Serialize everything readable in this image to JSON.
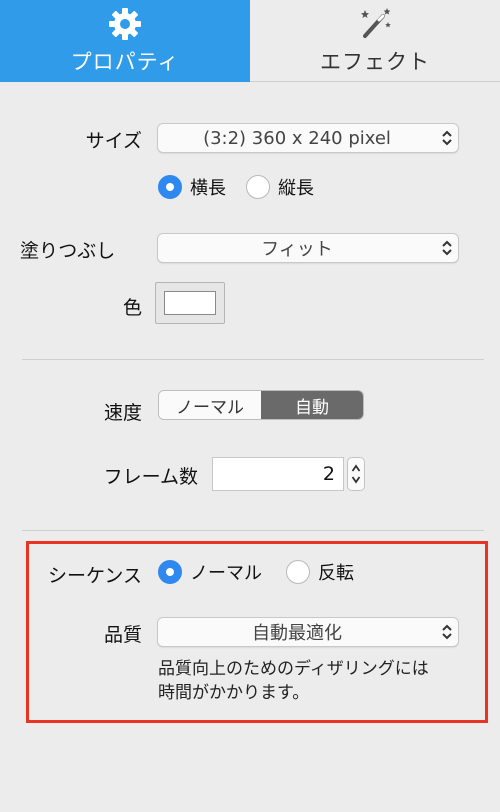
{
  "tabs": {
    "properties": {
      "label": "プロパティ",
      "icon": "gear-icon",
      "active": true,
      "color": "#2f9be9"
    },
    "effects": {
      "label": "エフェクト",
      "icon": "magic-wand-icon",
      "active": false
    }
  },
  "size": {
    "label": "サイズ",
    "value": "(3:2) 360 x 240 pixel",
    "orientation": [
      {
        "label": "横長",
        "selected": true
      },
      {
        "label": "縦長",
        "selected": false
      }
    ]
  },
  "fill": {
    "label": "塗りつぶし",
    "value": "フィット"
  },
  "color": {
    "label": "色",
    "value": "#ffffff"
  },
  "speed": {
    "label": "速度",
    "options": [
      {
        "label": "ノーマル",
        "selected": false
      },
      {
        "label": "自動",
        "selected": true
      }
    ]
  },
  "frames": {
    "label": "フレーム数",
    "value": "2"
  },
  "sequence": {
    "label": "シーケンス",
    "options": [
      {
        "label": "ノーマル",
        "selected": true
      },
      {
        "label": "反転",
        "selected": false
      }
    ]
  },
  "quality": {
    "label": "品質",
    "value": "自動最適化",
    "note": "品質向上のためのディザリングには\n時間がかかります。"
  },
  "highlight_color": "#ea3323",
  "accent_color": "#2e88ef"
}
